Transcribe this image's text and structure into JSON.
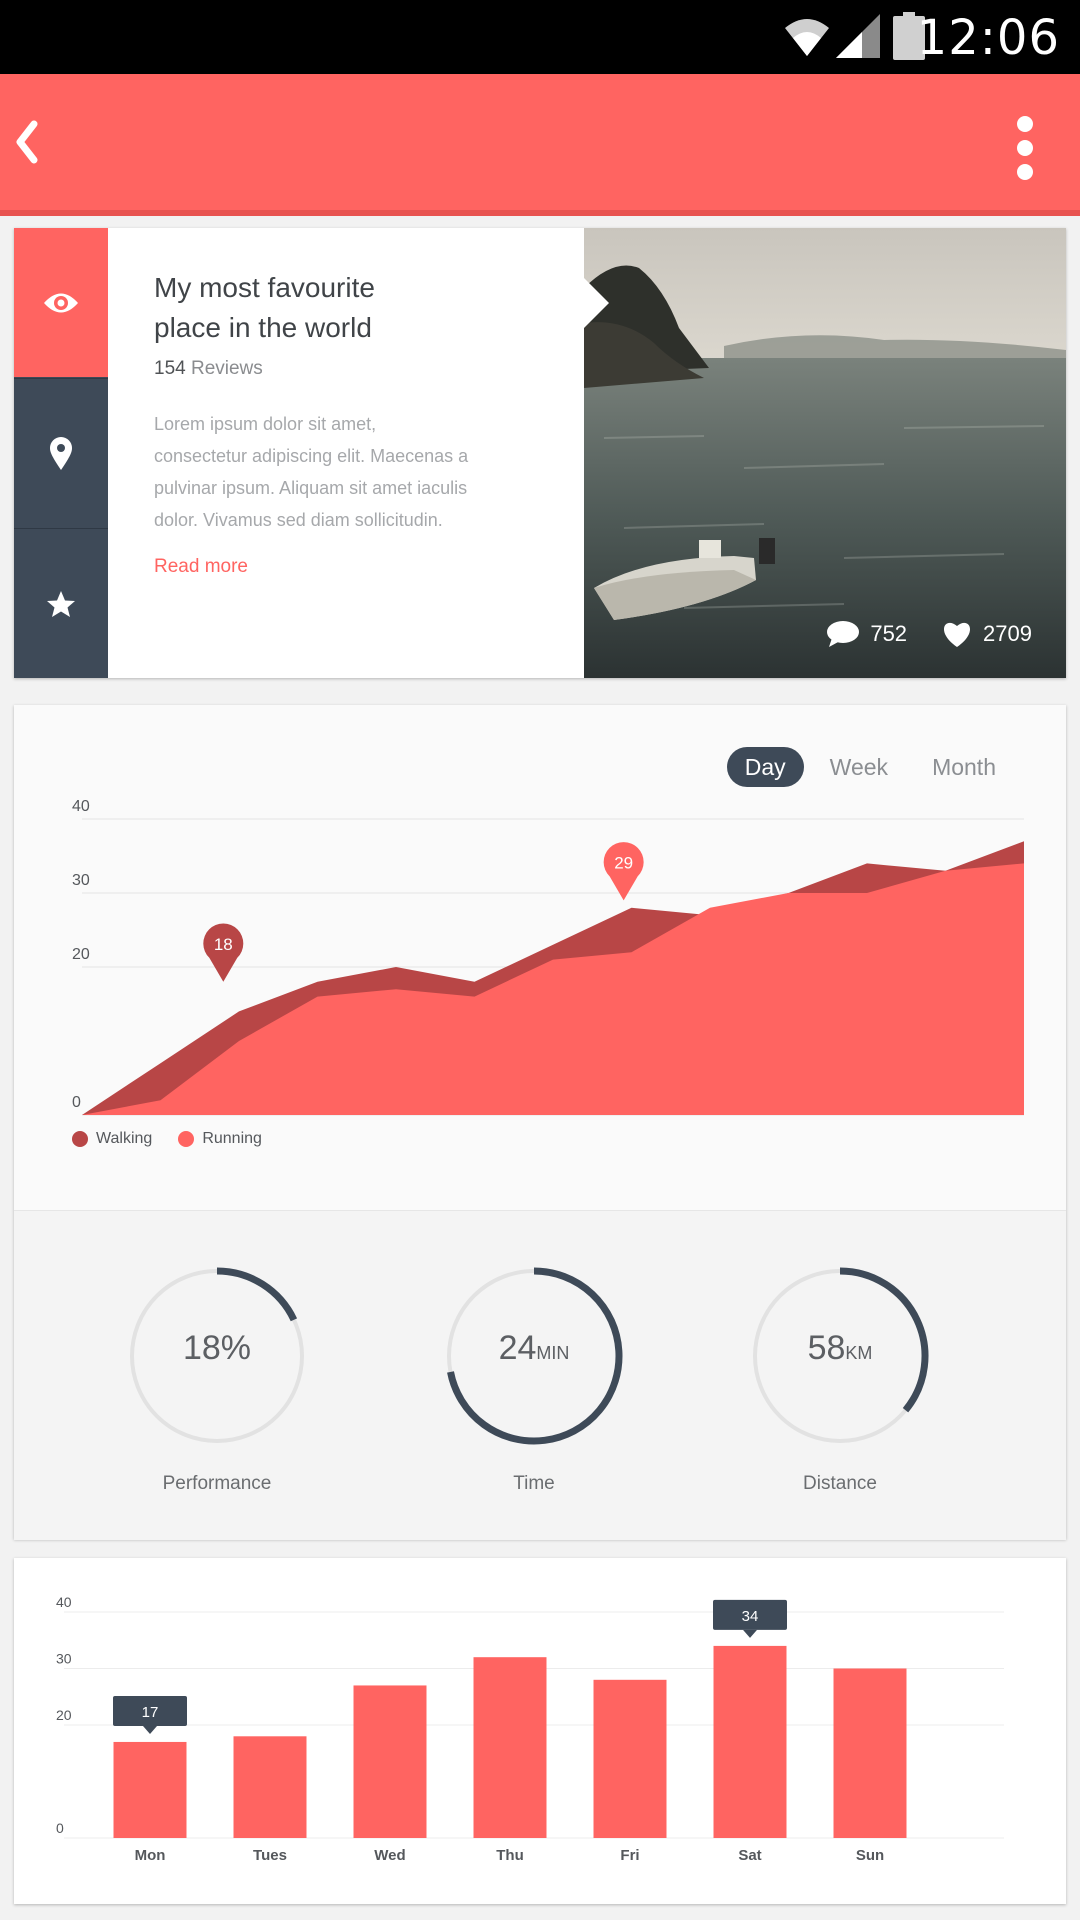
{
  "status_bar": {
    "time": "12:06"
  },
  "app_bar": {
    "back_icon": "chevron-left-icon",
    "menu_icon": "more-vert-icon"
  },
  "place_card": {
    "title_line1": "My most favourite",
    "title_line2": "place in the world",
    "review_count": "154",
    "review_label": "Reviews",
    "desc_lines": [
      "Lorem ipsum dolor sit amet,",
      "consectetur adipiscing elit. Maecenas a",
      "pulvinar ipsum. Aliquam sit amet iaculis",
      "dolor. Vivamus sed diam sollicitudin."
    ],
    "read_more": "Read more",
    "comments": "752",
    "likes": "2709",
    "side_tabs": [
      {
        "icon": "eye-icon",
        "active": true
      },
      {
        "icon": "location-pin-icon",
        "active": false
      },
      {
        "icon": "star-icon",
        "active": false
      }
    ],
    "colors": {
      "accent": "#ff6461",
      "dark": "#3e4a58"
    }
  },
  "period_tabs": [
    "Day",
    "Week",
    "Month"
  ],
  "selected_period": "Day",
  "metrics": [
    {
      "value": "18%",
      "unit": "",
      "label": "Performance",
      "fraction": 0.18
    },
    {
      "value": "24",
      "unit": "MIN",
      "label": "Time",
      "fraction": 0.72
    },
    {
      "value": "58",
      "unit": "KM",
      "label": "Distance",
      "fraction": 0.36
    }
  ],
  "chart_data": [
    {
      "type": "area",
      "y_ticks": [
        "40",
        "30",
        "20",
        "0"
      ],
      "ylim": [
        0,
        40
      ],
      "grid": true,
      "x": [
        0,
        1,
        2,
        3,
        4,
        5,
        6,
        7,
        8,
        9,
        10,
        11,
        12
      ],
      "series": [
        {
          "name": "Walking",
          "color": "#b84646",
          "values": [
            0,
            7,
            14,
            18,
            20,
            18,
            23,
            28,
            27,
            30,
            34,
            33,
            37
          ]
        },
        {
          "name": "Running",
          "color": "#ff6461",
          "values": [
            0,
            2,
            10,
            16,
            17,
            16,
            21,
            22,
            28,
            30,
            30,
            33,
            34
          ]
        }
      ],
      "markers": [
        {
          "label": "18",
          "series": "Walking",
          "x": 1.8,
          "value": 18
        },
        {
          "label": "29",
          "series": "Running",
          "x": 6.9,
          "value": 29
        }
      ]
    },
    {
      "type": "bar",
      "categories": [
        "Mon",
        "Tues",
        "Wed",
        "Thu",
        "Fri",
        "Sat",
        "Sun"
      ],
      "values": [
        17,
        18,
        27,
        32,
        28,
        34,
        30
      ],
      "y_ticks": [
        "40",
        "30",
        "20",
        "0"
      ],
      "ylim": [
        0,
        40
      ],
      "grid": true,
      "color": "#ff6461",
      "callouts": [
        {
          "label": "17",
          "index": 0
        },
        {
          "label": "34",
          "index": 5
        }
      ]
    }
  ]
}
